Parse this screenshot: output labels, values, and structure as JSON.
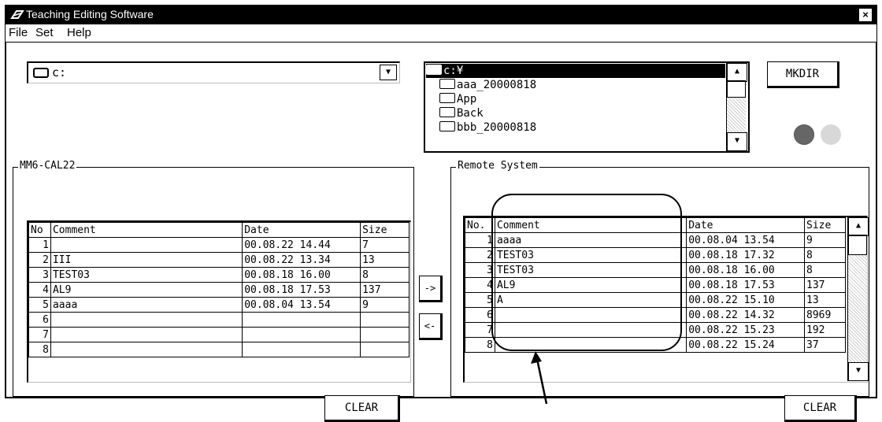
{
  "window": {
    "title": "Teaching Editing Software",
    "close_label": "×"
  },
  "menu": [
    "File",
    "Set",
    "Help"
  ],
  "drive": {
    "value": "c:",
    "icon": "drive-icon"
  },
  "folders": {
    "current": "c:¥",
    "items": [
      "aaa_20000818",
      "App",
      "Back",
      "bbb_20000818"
    ]
  },
  "buttons": {
    "mkdir": "MKDIR",
    "move_right": "->",
    "move_left": "<-",
    "clear_left": "CLEAR",
    "clear_right": "CLEAR"
  },
  "left_panel": {
    "title": "MM6-CAL22",
    "headers": [
      "No",
      "Comment",
      "Date",
      "Size"
    ],
    "rows": [
      [
        "1",
        "",
        "00.08.22 14.44",
        "7"
      ],
      [
        "2",
        "III",
        "00.08.22 13.34",
        "13"
      ],
      [
        "3",
        "TEST03",
        "00.08.18 16.00",
        "8"
      ],
      [
        "4",
        "AL9",
        "00.08.18 17.53",
        "137"
      ],
      [
        "5",
        "aaaa",
        "00.08.04 13.54",
        "9"
      ],
      [
        "6",
        "",
        "",
        ""
      ],
      [
        "7",
        "",
        "",
        ""
      ],
      [
        "8",
        "",
        "",
        ""
      ]
    ]
  },
  "right_panel": {
    "title": "Remote System",
    "headers": [
      "No.",
      "Comment",
      "Date",
      "Size"
    ],
    "rows": [
      [
        "1",
        "aaaa",
        "00.08.04 13.54",
        "9"
      ],
      [
        "2",
        "TEST03",
        "00.08.18 17.32",
        "8"
      ],
      [
        "3",
        "TEST03",
        "00.08.18 16.00",
        "8"
      ],
      [
        "4",
        "AL9",
        "00.08.18 17.53",
        "137"
      ],
      [
        "5",
        "A",
        "00.08.22 15.10",
        "13"
      ],
      [
        "6",
        "",
        "00.08.22 14.32",
        "8969"
      ],
      [
        "7",
        "",
        "00.08.22 15.23",
        "192"
      ],
      [
        "8",
        "",
        "00.08.22 15.24",
        "37"
      ]
    ]
  }
}
